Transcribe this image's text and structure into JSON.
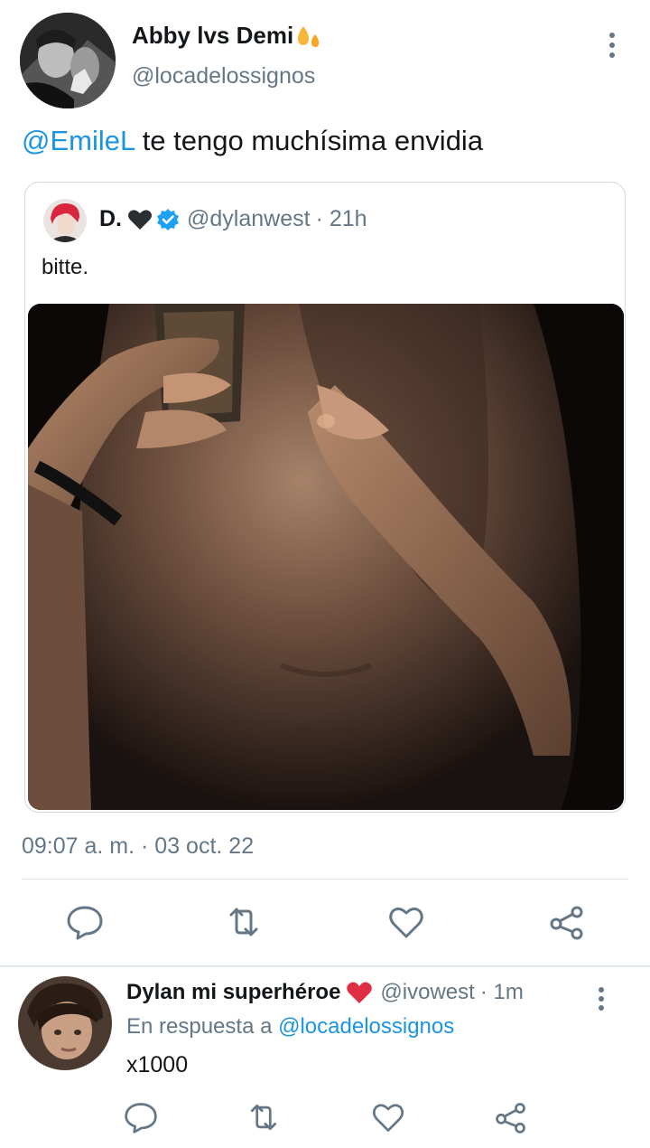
{
  "main_tweet": {
    "author_name": "Abby lvs Demi",
    "author_emoji": "flame-drops-icon",
    "author_handle": "@locadelossignos",
    "text_mention": "@EmileL",
    "text_body": " te tengo muchísima envidia",
    "timestamp": "09:07 a. m. · 03 oct. 22",
    "quoted": {
      "name": "D.",
      "name_icon": "black-heart-icon",
      "verified_icon": "verified-badge-icon",
      "handle": "@dylanwest",
      "time": "· 21h",
      "text": "bitte.",
      "media": "photo"
    },
    "actions": [
      "reply-icon",
      "retweet-icon",
      "like-icon",
      "share-icon"
    ]
  },
  "reply": {
    "author_name": "Dylan mi superhéroe",
    "author_icon": "red-heart-icon",
    "author_handle": "@ivowest",
    "time": "· 1m",
    "reply_to_prefix": "En respuesta a ",
    "reply_to_mention": "@locadelossignos",
    "text": "x1000",
    "actions": [
      "reply-icon",
      "retweet-icon",
      "like-icon",
      "share-icon"
    ]
  },
  "colors": {
    "accent": "#1b95e0",
    "secondary_text": "#657786",
    "primary_text": "#14171a",
    "divider": "#e1e8ed",
    "red_heart": "#e0245e"
  }
}
